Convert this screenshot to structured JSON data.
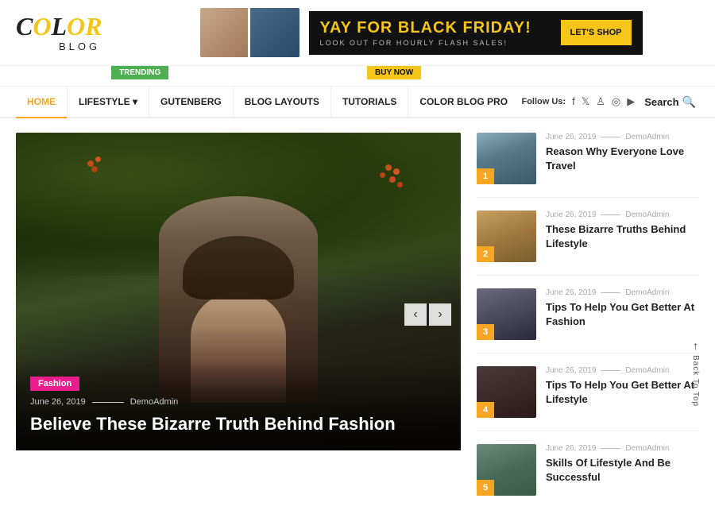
{
  "header": {
    "logo_color": "COLOR",
    "logo_blog": "BLOG",
    "banner_title": "YAY FOR BLACK FRIDAY!",
    "banner_sub": "LOOK OUT FOR HOURLY FLASH SALES!",
    "banner_btn": "LET'S SHOP"
  },
  "trending_bar": {
    "trending_label": "TRENDING",
    "buynow_label": "BUY NOW"
  },
  "nav": {
    "items": [
      {
        "label": "HOME",
        "active": true
      },
      {
        "label": "LIFESTYLE ▾",
        "active": false
      },
      {
        "label": "GUTENBERG",
        "active": false
      },
      {
        "label": "BLOG LAYOUTS",
        "active": false
      },
      {
        "label": "TUTORIALS",
        "active": false
      },
      {
        "label": "COLOR BLOG PRO",
        "active": false
      }
    ],
    "follow_us": "Follow Us:",
    "search_label": "Search"
  },
  "hero": {
    "category": "Fashion",
    "date": "June 26, 2019",
    "author": "DemoAdmin",
    "title": "Believe These Bizarre Truth Behind Fashion",
    "prev_label": "‹",
    "next_label": "›"
  },
  "sidebar": {
    "items": [
      {
        "num": "1",
        "date": "June 26, 2019",
        "author": "DemoAdmin",
        "title": "Reason Why Everyone Love Travel"
      },
      {
        "num": "2",
        "date": "June 26, 2019",
        "author": "DemoAdmin",
        "title": "These Bizarre Truths Behind Lifestyle"
      },
      {
        "num": "3",
        "date": "June 26, 2019",
        "author": "DemoAdmin",
        "title": "Tips To Help You Get Better At Fashion"
      },
      {
        "num": "4",
        "date": "June 26, 2019",
        "author": "DemoAdmin",
        "title": "Tips To Help You Get Better At Lifestyle"
      },
      {
        "num": "5",
        "date": "June 26, 2019",
        "author": "DemoAdmin",
        "title": "Skills Of Lifestyle And Be Successful"
      }
    ]
  },
  "back_to_top": "Back To Top",
  "social_icons": [
    "f",
    "𝕏",
    "𝐏",
    "◎",
    "▶"
  ],
  "colors": {
    "accent_yellow": "#f5c518",
    "accent_green": "#4CAF50",
    "accent_pink": "#e91e8c",
    "accent_orange": "#f5a623"
  }
}
